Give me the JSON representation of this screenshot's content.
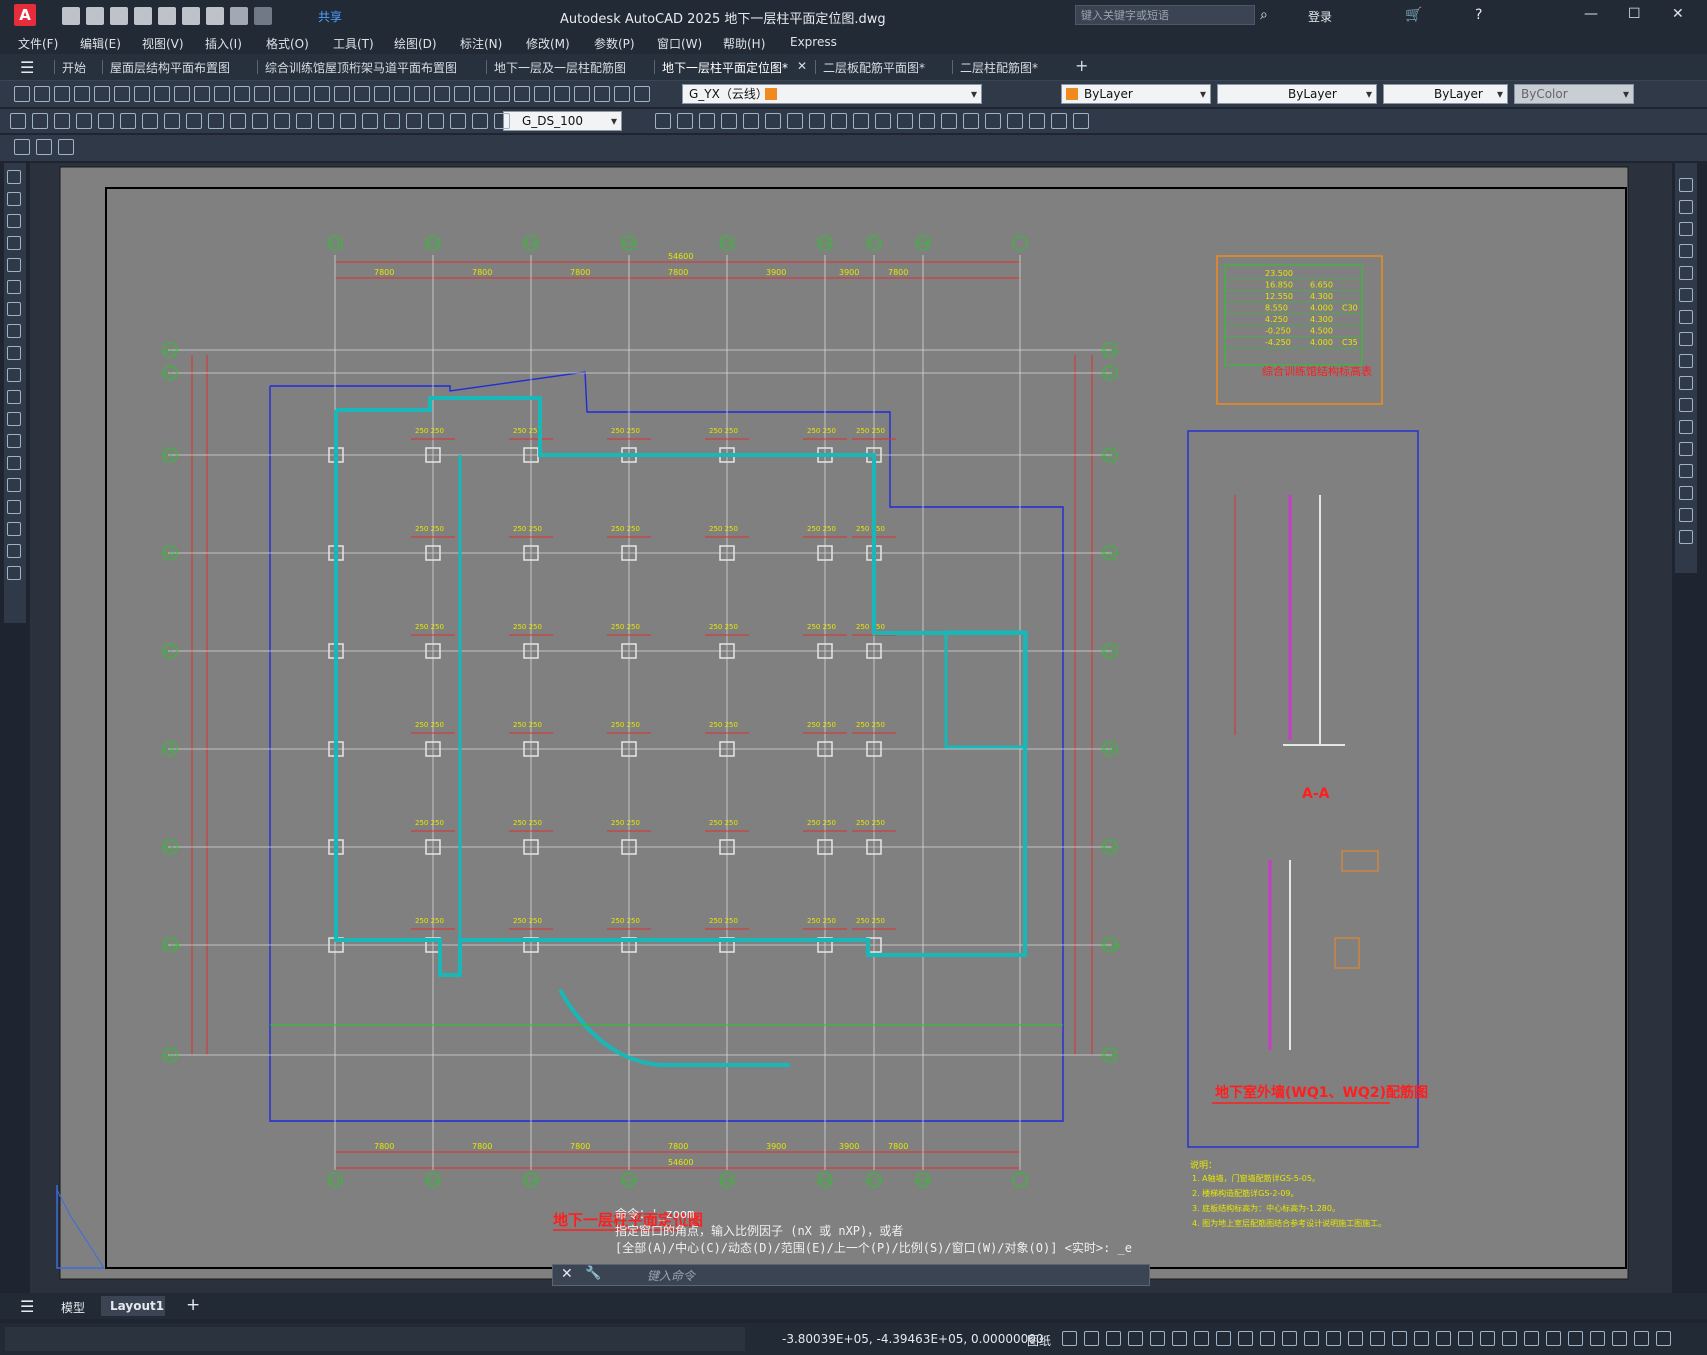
{
  "app": {
    "title": "Autodesk AutoCAD 2025    地下一层柱平面定位图.dwg",
    "logo": "A",
    "share": "共享",
    "search_placeholder": "键入关键字或短语",
    "login": "登录"
  },
  "menu": [
    "文件(F)",
    "编辑(E)",
    "视图(V)",
    "插入(I)",
    "格式(O)",
    "工具(T)",
    "绘图(D)",
    "标注(N)",
    "修改(M)",
    "参数(P)",
    "窗口(W)",
    "帮助(H)",
    "Express"
  ],
  "tabs": [
    {
      "label": "开始"
    },
    {
      "label": "屋面层结构平面布置图"
    },
    {
      "label": "综合训练馆屋顶桁架马道平面布置图"
    },
    {
      "label": "地下一层及一层柱配筋图"
    },
    {
      "label": "地下一层柱平面定位图*",
      "active": true
    },
    {
      "label": "二层板配筋平面图*"
    },
    {
      "label": "二层柱配筋图*"
    }
  ],
  "toolbar": {
    "layer": "G_YX（云线）",
    "color": "ByLayer",
    "linetype": "ByLayer",
    "lineweight": "ByLayer",
    "plotstyle": "ByColor",
    "dimstyle": "G_DS_100"
  },
  "drawing": {
    "title": "地下一层柱平面定位图",
    "grid_top": [
      "S-1",
      "S-2",
      "S-3",
      "S-4",
      "S-5",
      "S-6",
      "S-7",
      "S-8"
    ],
    "grid_left": [
      "S-G",
      "S-F",
      "S-E",
      "S-D",
      "S-C",
      "S-B",
      "S-A",
      "S-1/A",
      "S-H"
    ],
    "dims_top": [
      "7800",
      "7800",
      "7800",
      "7800",
      "3900",
      "3900",
      "7800"
    ],
    "total_dim": "54600",
    "table_title": "综合训练馆结构标高表",
    "table_rows": [
      [
        "23.500",
        "",
        ""
      ],
      [
        "16.850",
        "6.650",
        ""
      ],
      [
        "12.550",
        "4.300",
        ""
      ],
      [
        "8.550",
        "4.000",
        "C30"
      ],
      [
        "4.250",
        "4.300",
        ""
      ],
      [
        "-0.250",
        "4.500",
        ""
      ],
      [
        "-4.250",
        "4.000",
        "C35"
      ]
    ],
    "section_aa": "A-A",
    "wall_title": "地下室外墙(WQ1、WQ2)配筋图",
    "notes_title": "说明：",
    "notes": [
      "1. A轴墙，门窗墙配筋详GS-5-05。",
      "2. 楼梯构造配筋详GS-2-09。",
      "3. 底板结构标高为：中心标高为-1.280。",
      "4. 图为地上室层配筋图结合参考设计说明施工图施工。"
    ]
  },
  "command": {
    "title": "命令：'_zoom",
    "line1": "指定窗口的角点，输入比例因子 (nX 或 nXP)，或者",
    "line2": "[全部(A)/中心(C)/动态(D)/范围(E)/上一个(P)/比例(S)/窗口(W)/对象(O)] <实时>: _e",
    "placeholder": "键入命令"
  },
  "layouts": [
    "模型",
    "Layout1"
  ],
  "status": {
    "coords": "-3.80039E+05, -4.39463E+05, 0.00000000",
    "paper": "图纸"
  }
}
